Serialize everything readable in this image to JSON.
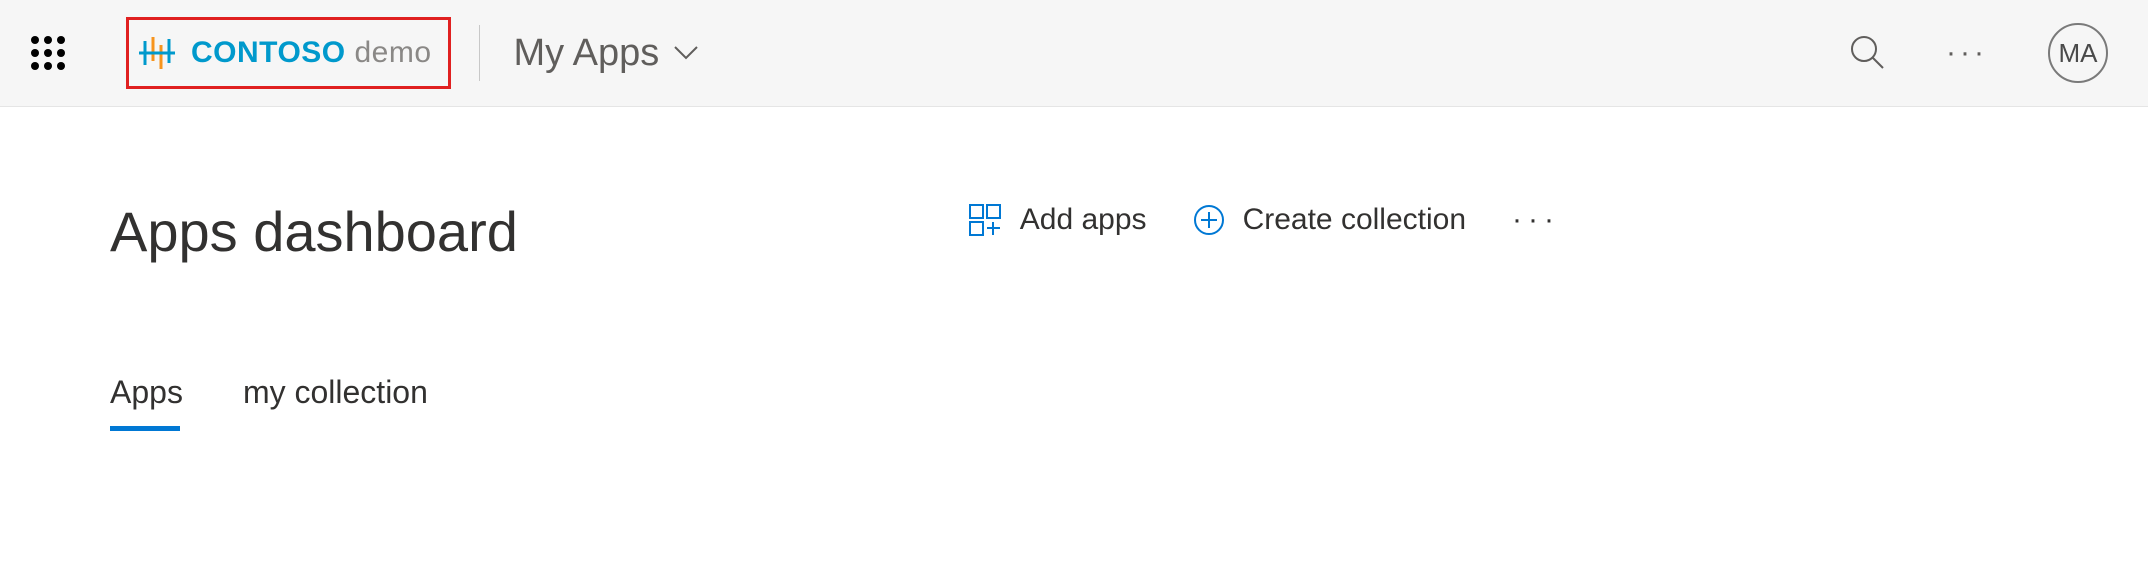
{
  "header": {
    "brand_name": "CONTOSO",
    "brand_sub": "demo",
    "app_dropdown_label": "My Apps",
    "user_initials": "MA"
  },
  "page": {
    "title": "Apps dashboard",
    "actions": {
      "add_apps": "Add apps",
      "create_collection": "Create collection"
    },
    "tabs": [
      {
        "label": "Apps",
        "active": true
      },
      {
        "label": "my collection",
        "active": false
      }
    ]
  }
}
